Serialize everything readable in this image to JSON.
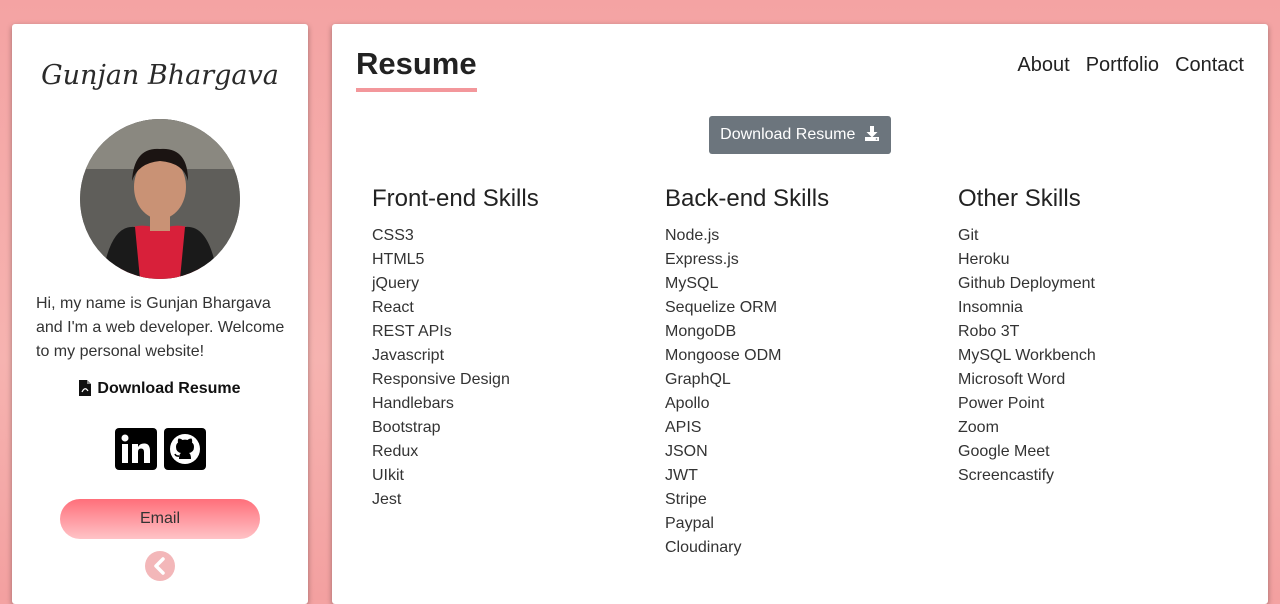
{
  "sidebar": {
    "name": "Gunjan Bhargava",
    "intro": "Hi, my name is Gunjan Bhargava and I'm a web developer. Welcome to my personal website!",
    "download_label": "Download Resume",
    "email_label": "Email",
    "social_icons": [
      "linkedin-icon",
      "github-icon"
    ]
  },
  "main": {
    "title": "Resume",
    "nav": [
      "About",
      "Portfolio",
      "Contact"
    ],
    "download_button": "Download Resume",
    "columns": [
      {
        "heading": "Front-end Skills",
        "items": [
          "CSS3",
          "HTML5",
          "jQuery",
          "React",
          "REST APIs",
          "Javascript",
          "Responsive Design",
          "Handlebars",
          "Bootstrap",
          "Redux",
          "UIkit",
          "Jest"
        ]
      },
      {
        "heading": "Back-end Skills",
        "items": [
          "Node.js",
          "Express.js",
          "MySQL",
          "Sequelize ORM",
          "MongoDB",
          "Mongoose ODM",
          "GraphQL",
          "Apollo",
          "APIS",
          "JSON",
          "JWT",
          "Stripe",
          "Paypal",
          "Cloudinary"
        ]
      },
      {
        "heading": "Other Skills",
        "items": [
          "Git",
          "Heroku",
          "Github Deployment",
          "Insomnia",
          "Robo 3T",
          "MySQL Workbench",
          "Microsoft Word",
          "Power Point",
          "Zoom",
          "Google Meet",
          "Screencastify"
        ]
      }
    ]
  },
  "colors": {
    "accent": "#f3979b",
    "button_gray": "#6c757d",
    "background": "#f4a3a3"
  }
}
